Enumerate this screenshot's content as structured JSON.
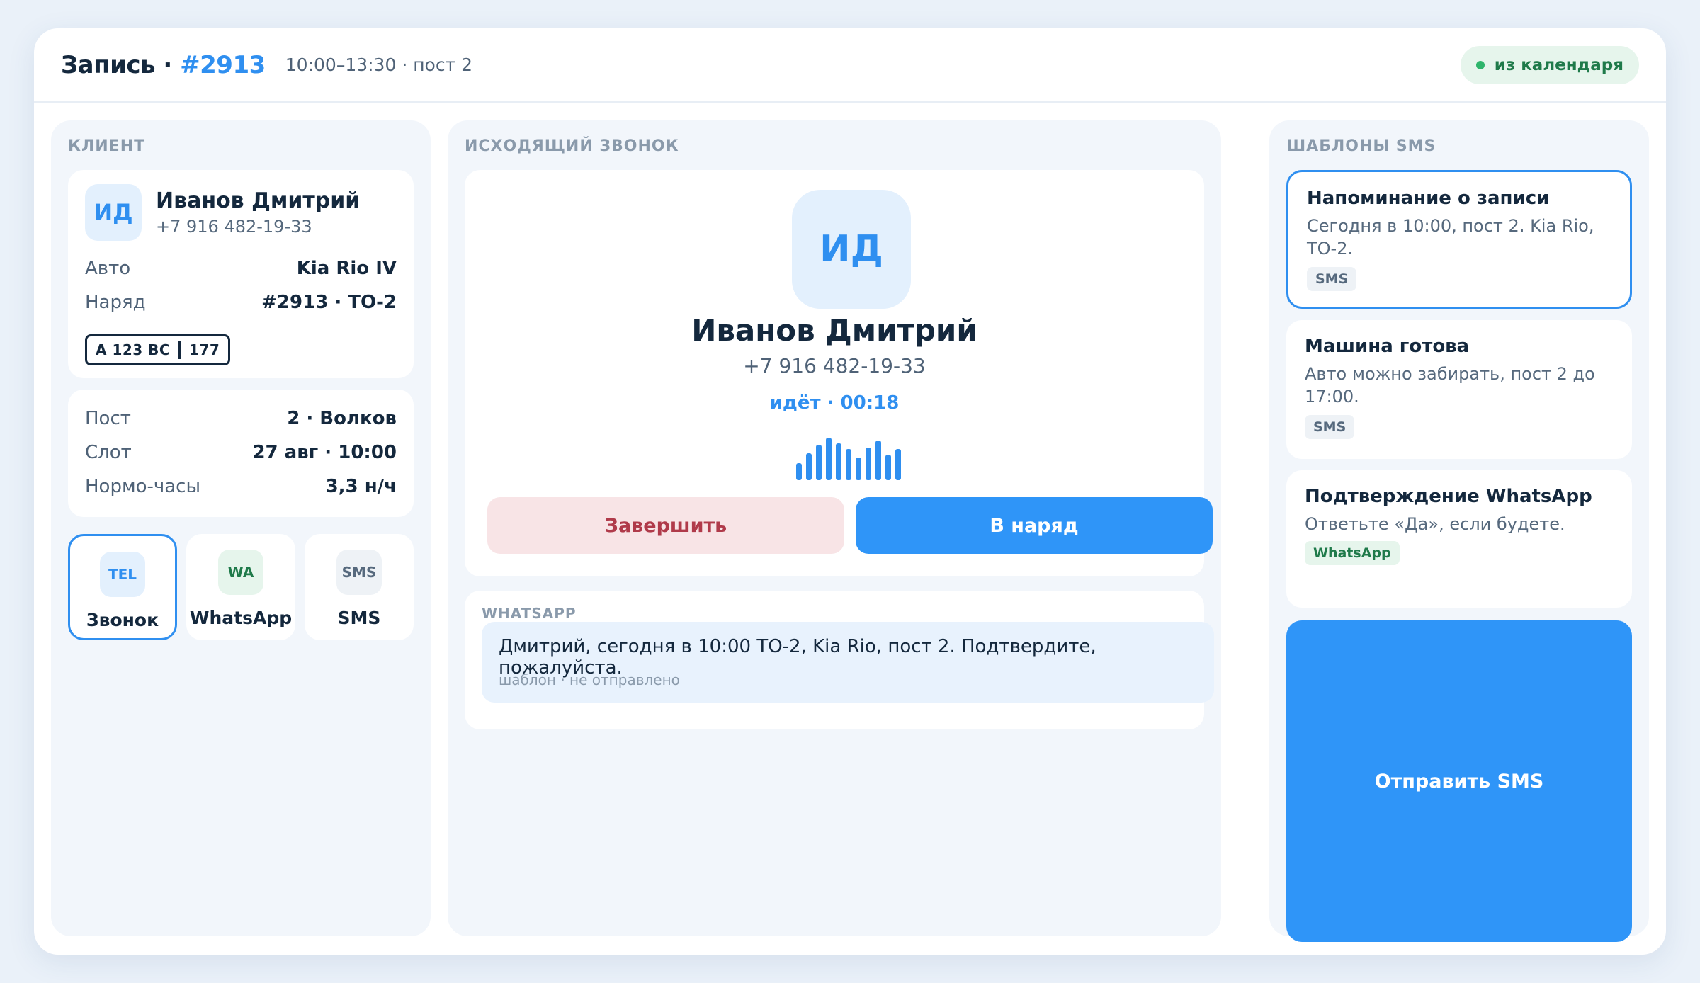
{
  "header": {
    "title_prefix": "Запись · ",
    "title_number": "#2913",
    "subtitle": "10:00–13:30 · пост 2",
    "badge": "из календаря"
  },
  "client": {
    "section_label": "КЛИЕНТ",
    "initials": "ИД",
    "name": "Иванов Дмитрий",
    "phone": "+7 916 482-19-33",
    "car_label": "Авто",
    "car_value": "Kia Rio IV",
    "order_label": "Наряд",
    "order_value": "#2913 · ТО-2",
    "plate_main": "А 123 ВС",
    "plate_region": "177",
    "post_label": "Пост",
    "post_value": "2 · Волков",
    "slot_label": "Слот",
    "slot_value": "27 авг · 10:00",
    "hours_label": "Нормо-часы",
    "hours_value": "3,3 н/ч"
  },
  "channels": [
    {
      "icon": "TEL",
      "label": "Звонок"
    },
    {
      "icon": "WA",
      "label": "WhatsApp"
    },
    {
      "icon": "SMS",
      "label": "SMS"
    }
  ],
  "call": {
    "section_label": "ИСХОДЯЩИЙ ЗВОНОК",
    "initials": "ИД",
    "name": "Иванов Дмитрий",
    "phone": "+7 916 482-19-33",
    "status": "идёт · 00:18",
    "end_label": "Завершить",
    "order_label": "В наряд"
  },
  "whatsapp": {
    "label": "WHATSAPP",
    "message": "Дмитрий, сегодня в 10:00 ТО-2, Kia Rio, пост 2. Подтвердите, пожалуйста.",
    "meta": "шаблон · не отправлено"
  },
  "templates": {
    "section_label": "ШАБЛОНЫ SMS",
    "items": [
      {
        "title": "Напоминание о записи",
        "body": "Сегодня в 10:00, пост 2. Kia Rio, ТО-2.",
        "tag": "SMS"
      },
      {
        "title": "Машина готова",
        "body": "Авто можно забирать, пост 2 до 17:00.",
        "tag": "SMS"
      },
      {
        "title": "Подтверждение WhatsApp",
        "body": "Ответьте «Да», если будете.",
        "tag": "WhatsApp"
      }
    ],
    "send_label": "Отправить SMS"
  },
  "colors": {
    "accent": "#2f8ff0",
    "danger_bg": "#f8e4e6",
    "danger_text": "#b03a4a",
    "success_text": "#1f7a4a"
  }
}
